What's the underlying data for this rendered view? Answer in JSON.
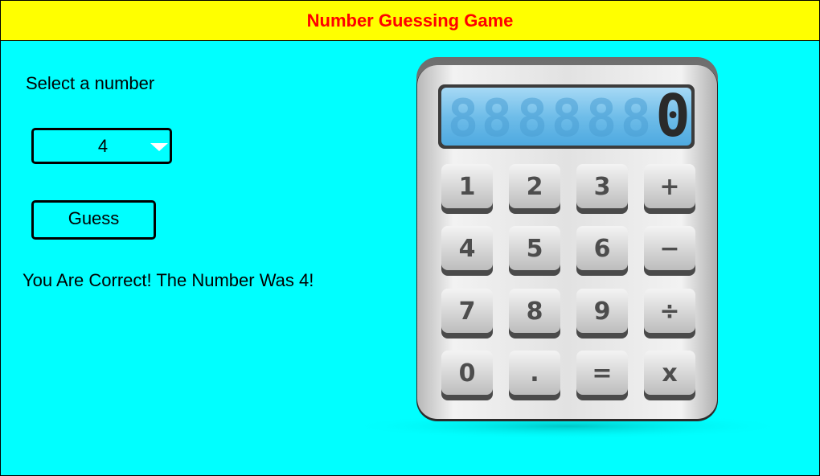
{
  "header": {
    "title": "Number Guessing Game",
    "bg_color": "#ffff00",
    "title_color": "#ff0000"
  },
  "main": {
    "bg_color": "#00ffff",
    "select_label": "Select a number",
    "select_value": "4",
    "guess_label": "Guess",
    "result_text": "You Are Correct! The Number Was 4!"
  },
  "calculator": {
    "display_digit": "0",
    "ghost_digits": [
      "8",
      "8",
      "8",
      "8",
      "8",
      "8"
    ],
    "keys": [
      {
        "label": "1"
      },
      {
        "label": "2"
      },
      {
        "label": "3"
      },
      {
        "label": "+"
      },
      {
        "label": "4"
      },
      {
        "label": "5"
      },
      {
        "label": "6"
      },
      {
        "label": "−"
      },
      {
        "label": "7"
      },
      {
        "label": "8"
      },
      {
        "label": "9"
      },
      {
        "label": "÷"
      },
      {
        "label": "0"
      },
      {
        "label": "."
      },
      {
        "label": "="
      },
      {
        "label": "x"
      }
    ]
  }
}
